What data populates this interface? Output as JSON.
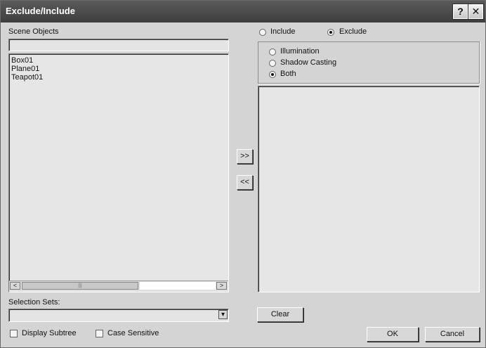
{
  "window": {
    "title": "Exclude/Include",
    "help_glyph": "?",
    "close_glyph": "✕"
  },
  "left": {
    "scene_objects_label": "Scene Objects",
    "filter_value": "",
    "objects": [
      "Box01",
      "Plane01",
      "Teapot01"
    ],
    "scroll_left_glyph": "<",
    "scroll_right_glyph": ">",
    "scroll_grip_glyph": "|||",
    "selection_sets_label": "Selection Sets:",
    "selection_sets_value": "",
    "dropdown_glyph": "▾",
    "display_subtree_label": "Display Subtree",
    "case_sensitive_label": "Case Sensitive"
  },
  "middle": {
    "move_right_label": ">>",
    "move_left_label": "<<"
  },
  "right": {
    "mode": {
      "include_label": "Include",
      "exclude_label": "Exclude",
      "selected": "Exclude"
    },
    "type": {
      "illumination_label": "Illumination",
      "shadow_casting_label": "Shadow Casting",
      "both_label": "Both",
      "selected": "Both"
    },
    "clear_label": "Clear",
    "ok_label": "OK",
    "cancel_label": "Cancel"
  },
  "icons": [
    "help-icon",
    "close-icon",
    "scroll-left-icon",
    "scroll-right-icon",
    "dropdown-arrow-icon"
  ]
}
